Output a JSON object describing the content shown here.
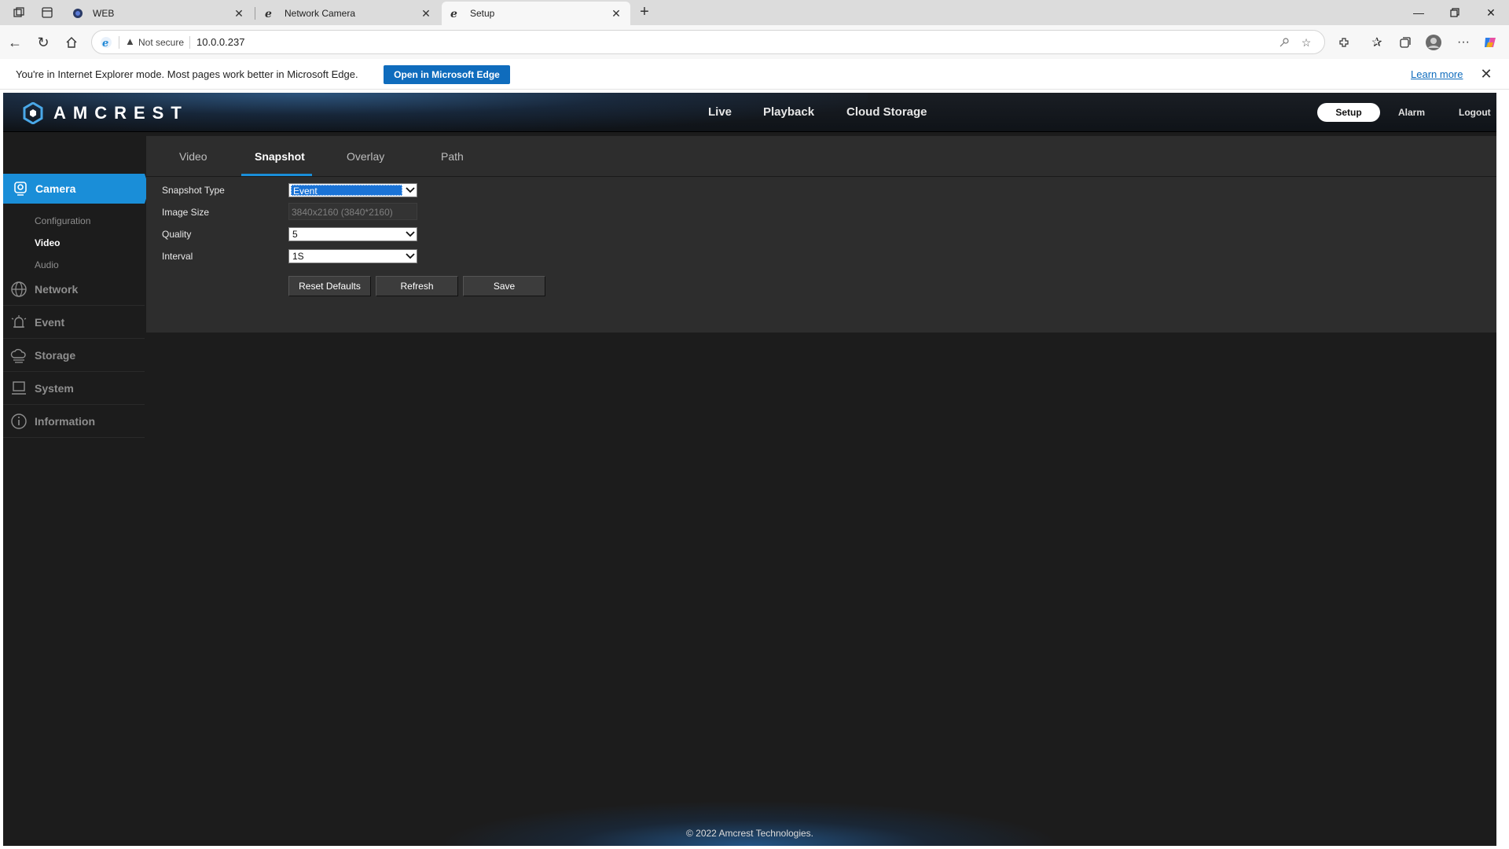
{
  "browser": {
    "tabs": [
      {
        "title": "WEB",
        "icon": "globe-icon"
      },
      {
        "title": "Network Camera",
        "icon": "ie-icon"
      },
      {
        "title": "Setup",
        "icon": "ie-icon",
        "active": true
      }
    ],
    "address": {
      "security_label": "Not secure",
      "url": "10.0.0.237"
    },
    "infobar": {
      "message": "You're in Internet Explorer mode. Most pages work better in Microsoft Edge.",
      "open_button": "Open in Microsoft Edge",
      "learn_more": "Learn more"
    }
  },
  "app": {
    "brand": "AMCREST",
    "top_nav": [
      "Live",
      "Playback",
      "Cloud Storage"
    ],
    "header_right": {
      "setup": "Setup",
      "alarm": "Alarm",
      "logout": "Logout"
    },
    "sidebar": {
      "camera": {
        "label": "Camera",
        "children": [
          "Configuration",
          "Video",
          "Audio"
        ],
        "active_child": "Video"
      },
      "items": [
        {
          "label": "Network",
          "icon": "network-globe-icon"
        },
        {
          "label": "Event",
          "icon": "alarm-bell-icon"
        },
        {
          "label": "Storage",
          "icon": "storage-cloud-icon"
        },
        {
          "label": "System",
          "icon": "monitor-icon"
        },
        {
          "label": "Information",
          "icon": "info-icon"
        }
      ]
    },
    "subtabs": [
      "Video",
      "Snapshot",
      "Overlay",
      "Path"
    ],
    "active_subtab": "Snapshot",
    "form": {
      "snapshot_type": {
        "label": "Snapshot Type",
        "value": "Event"
      },
      "image_size": {
        "label": "Image Size",
        "value": "3840x2160 (3840*2160)"
      },
      "quality": {
        "label": "Quality",
        "value": "5"
      },
      "interval": {
        "label": "Interval",
        "value": "1S"
      }
    },
    "buttons": {
      "reset": "Reset Defaults",
      "refresh": "Refresh",
      "save": "Save"
    },
    "footer": "© 2022 Amcrest Technologies.",
    "colors": {
      "accent": "#1a8ed8",
      "background": "#1c1c1c",
      "panel": "#2d2d2d",
      "edge_blue": "#0f6cbd"
    }
  }
}
